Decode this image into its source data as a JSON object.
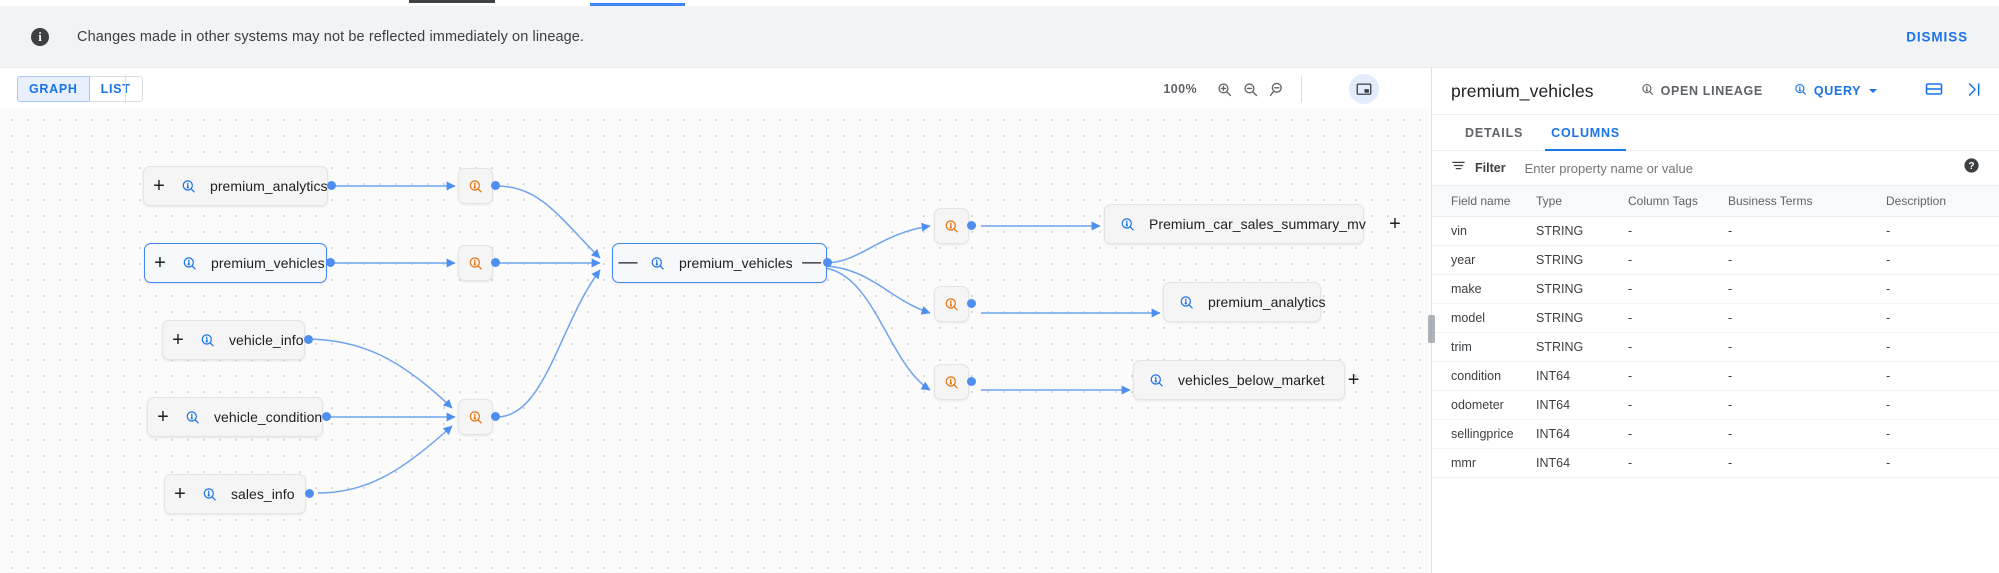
{
  "banner": {
    "icon": "info-icon",
    "message": "Changes made in other systems may not be reflected immediately on lineage.",
    "dismiss_label": "DISMISS"
  },
  "graph_toolbar": {
    "view_modes": [
      {
        "label": "GRAPH",
        "active": true
      },
      {
        "label": "LIST",
        "active": false
      }
    ],
    "zoom_level": "100%",
    "zoom_in_icon": "zoom-in-icon",
    "zoom_out_icon": "zoom-out-icon",
    "zoom_reset_icon": "zoom-reset-icon",
    "minimap_icon": "minimap-icon"
  },
  "graph": {
    "upstream_nodes": [
      {
        "label": "premium_analytics",
        "expand": "+",
        "selected": false
      },
      {
        "label": "premium_vehicles",
        "expand": "+",
        "selected": true
      },
      {
        "label": "vehicle_info",
        "expand": "+",
        "selected": false
      },
      {
        "label": "vehicle_condition",
        "expand": "+",
        "selected": false
      },
      {
        "label": "sales_info",
        "expand": "+",
        "selected": false
      }
    ],
    "process_nodes": [
      {
        "name": "process-node-1",
        "icon": "process-icon"
      },
      {
        "name": "process-node-2",
        "icon": "process-icon"
      },
      {
        "name": "process-node-3",
        "icon": "process-icon"
      },
      {
        "name": "process-node-4",
        "icon": "process-icon"
      },
      {
        "name": "process-node-5",
        "icon": "process-icon"
      },
      {
        "name": "process-node-6",
        "icon": "process-icon"
      }
    ],
    "focus_node": {
      "label": "premium_vehicles",
      "collapse_left": "—",
      "collapse_right": "—",
      "selected": true
    },
    "downstream_nodes": [
      {
        "label": "Premium_car_sales_summary_mv",
        "expand": "+"
      },
      {
        "label": "premium_analytics",
        "expand": ""
      },
      {
        "label": "vehicles_below_market",
        "expand": "+"
      }
    ],
    "colors": {
      "edge": "#6ea3ef",
      "port": "#4e8ef0",
      "selected_border": "#4285f4",
      "process_icon": "#e8710a",
      "table_icon": "#1a73e8"
    }
  },
  "panel": {
    "title": "premium_vehicles",
    "open_lineage_label": "OPEN LINEAGE",
    "open_lineage_icon": "lineage-icon",
    "query_label": "QUERY",
    "query_icon": "query-icon",
    "split_view_icon": "split-view-icon",
    "collapse_panel_icon": "collapse-right-icon",
    "tabs": [
      {
        "label": "DETAILS",
        "active": false
      },
      {
        "label": "COLUMNS",
        "active": true
      }
    ],
    "filter": {
      "icon": "filter-icon",
      "label": "Filter",
      "placeholder": "Enter property name or value",
      "value": "",
      "help_icon": "help-icon"
    },
    "table": {
      "headers": [
        "Field name",
        "Type",
        "Column Tags",
        "Business Terms",
        "Description"
      ],
      "rows": [
        [
          "vin",
          "STRING",
          "-",
          "-",
          "-"
        ],
        [
          "year",
          "STRING",
          "-",
          "-",
          "-"
        ],
        [
          "make",
          "STRING",
          "-",
          "-",
          "-"
        ],
        [
          "model",
          "STRING",
          "-",
          "-",
          "-"
        ],
        [
          "trim",
          "STRING",
          "-",
          "-",
          "-"
        ],
        [
          "condition",
          "INT64",
          "-",
          "-",
          "-"
        ],
        [
          "odometer",
          "INT64",
          "-",
          "-",
          "-"
        ],
        [
          "sellingprice",
          "INT64",
          "-",
          "-",
          "-"
        ],
        [
          "mmr",
          "INT64",
          "-",
          "-",
          "-"
        ]
      ]
    }
  }
}
